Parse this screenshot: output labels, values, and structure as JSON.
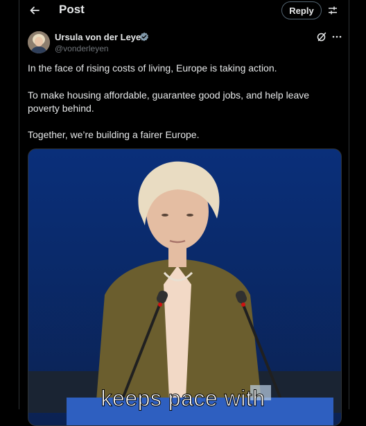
{
  "header": {
    "title": "Post",
    "reply_label": "Reply"
  },
  "author": {
    "name": "Ursula von der Leyen",
    "handle": "@vonderleyen",
    "verified": true
  },
  "post": {
    "paragraphs": [
      "In the face of rising costs of living, Europe is taking action.",
      "To make housing affordable, guarantee good jobs, and help leave poverty behind.",
      "Together, we’re building a fairer Europe."
    ]
  },
  "media": {
    "type": "video",
    "caption": "keeps pace with"
  },
  "icons": {
    "back": "arrow-left-icon",
    "settings": "sliders-icon",
    "verified": "verified-badge-icon",
    "grok": "grok-icon",
    "more": "more-horizontal-icon"
  },
  "colors": {
    "background": "#000000",
    "text": "#e7e9ea",
    "secondary_text": "#71767b",
    "border": "#2f3336",
    "verified": "#829aab"
  }
}
